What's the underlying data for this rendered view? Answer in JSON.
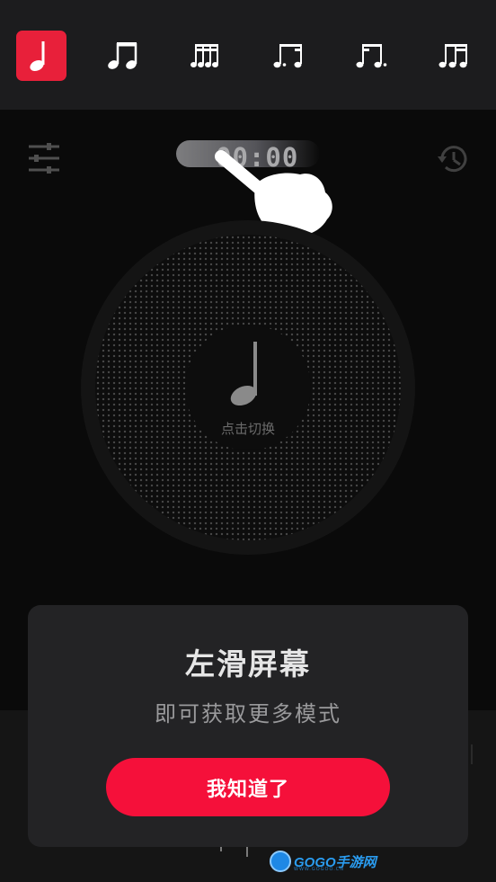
{
  "rhythm_bar": {
    "items": [
      {
        "name": "quarter-note",
        "active": true
      },
      {
        "name": "eighth-notes",
        "active": false
      },
      {
        "name": "sixteenth-notes",
        "active": false
      },
      {
        "name": "dotted-eighth-sixteenth",
        "active": false
      },
      {
        "name": "sixteenth-dotted-eighth",
        "active": false
      },
      {
        "name": "triplet-notes",
        "active": false
      }
    ]
  },
  "header": {
    "settings_icon": "sliders-icon",
    "timer": "00:00",
    "history_icon": "history-icon"
  },
  "disc": {
    "note_icon": "quarter-note-icon",
    "label": "点击切换"
  },
  "dialog": {
    "title": "左滑屏幕",
    "subtitle": "即可获取更多模式",
    "button_label": "我知道了"
  },
  "watermark": {
    "text": "GOGO手游网",
    "sub": "WWW.GOGOO.CN"
  },
  "colors": {
    "accent": "#f5103a",
    "active_tile": "#e8203a",
    "topbar_bg": "#1c1c1e",
    "dialog_bg": "#232325"
  }
}
